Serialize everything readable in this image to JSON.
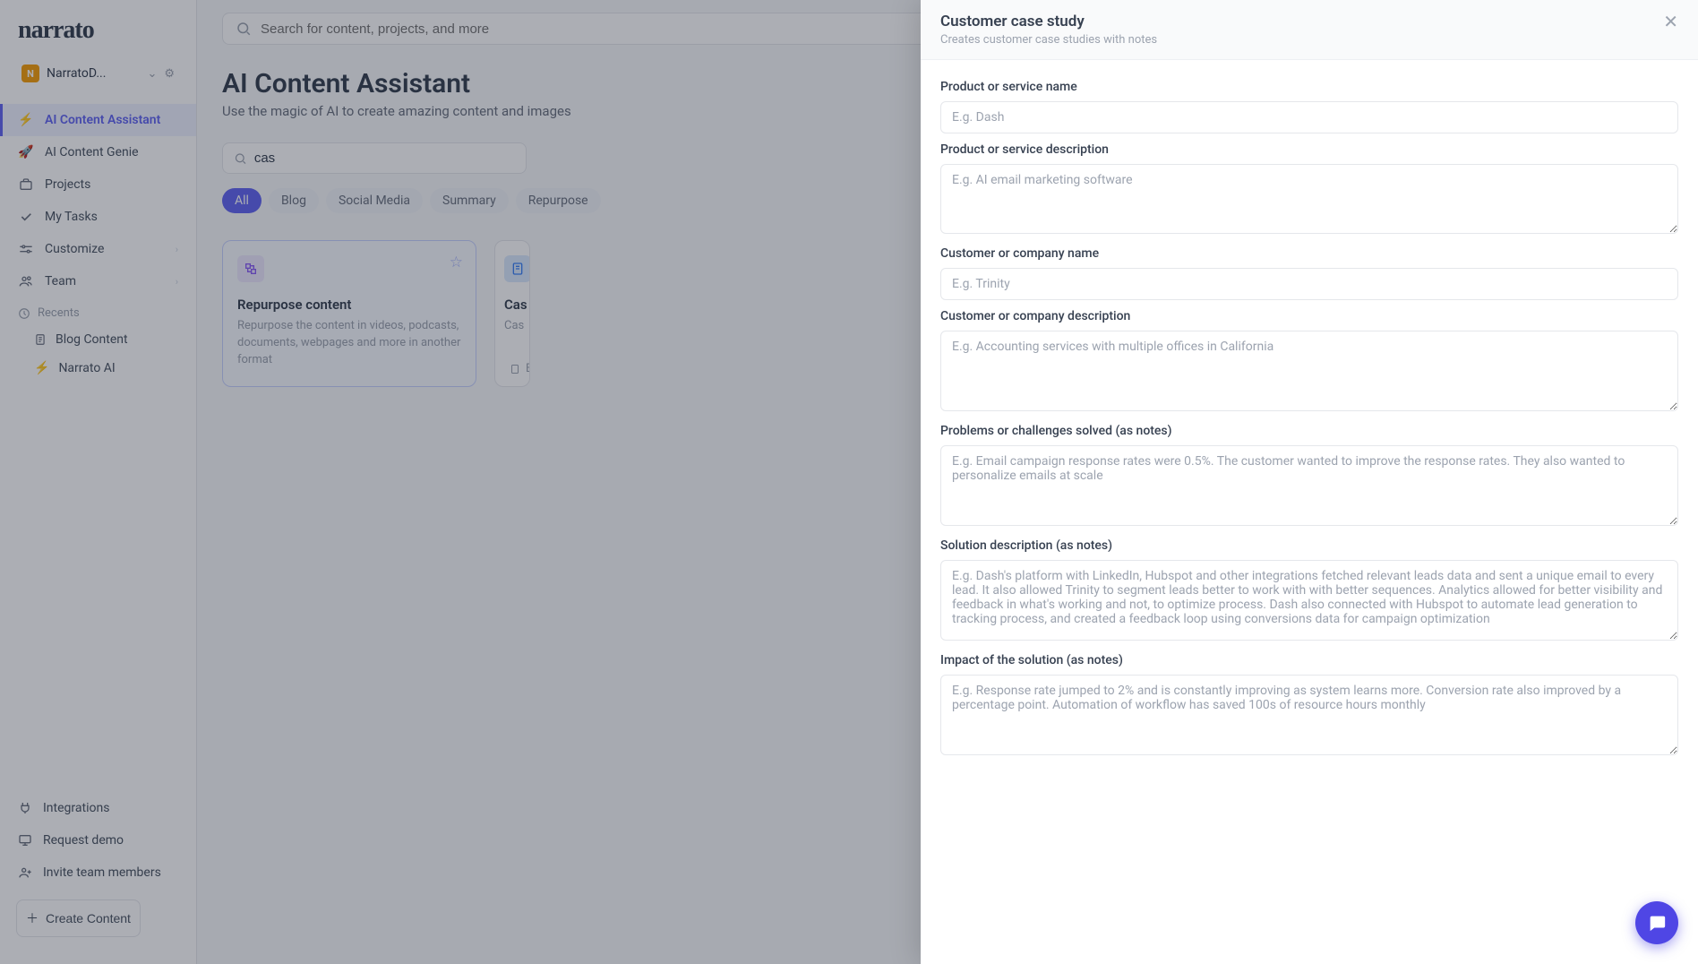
{
  "brand": "narrato",
  "workspace": {
    "badge": "N",
    "name": "NarratoD..."
  },
  "nav": {
    "ai_assistant": "AI Content Assistant",
    "ai_genie": "AI Content Genie",
    "projects": "Projects",
    "my_tasks": "My Tasks",
    "customize": "Customize",
    "team": "Team",
    "recents_label": "Recents",
    "recents": [
      {
        "label": "Blog Content",
        "icon": "doc"
      },
      {
        "label": "Narrato AI",
        "icon": "bolt"
      }
    ]
  },
  "bottom_nav": {
    "integrations": "Integrations",
    "request_demo": "Request demo",
    "invite": "Invite team members",
    "create": "Create Content"
  },
  "search_placeholder": "Search for content, projects, and more",
  "page": {
    "title": "AI Content Assistant",
    "subtitle": "Use the magic of AI to create amazing content and images"
  },
  "filter_search_value": "cas",
  "chips": [
    "All",
    "Blog",
    "Social Media",
    "Summary",
    "Repurpose"
  ],
  "active_chip": "All",
  "cards": [
    {
      "title": "Repurpose content",
      "desc": "Repurpose the content in videos, podcasts, documents, webpages and more in another format",
      "icon_bg": "#ede9fe",
      "icon_color": "#8b5cf6",
      "highlight": true
    },
    {
      "title": "Cas",
      "desc": "Cas",
      "footer": "B",
      "icon_bg": "#dbeafe",
      "icon_color": "#3b82f6",
      "highlight": false
    }
  ],
  "modal": {
    "title": "Customer case study",
    "subtitle": "Creates customer case studies with notes",
    "fields": {
      "product_name": {
        "label": "Product or service name",
        "placeholder": "E.g. Dash"
      },
      "product_desc": {
        "label": "Product or service description",
        "placeholder": "E.g. AI email marketing software"
      },
      "customer_name": {
        "label": "Customer or company name",
        "placeholder": "E.g. Trinity"
      },
      "customer_desc": {
        "label": "Customer or company description",
        "placeholder": "E.g. Accounting services with multiple offices in California"
      },
      "problems": {
        "label": "Problems or challenges solved (as notes)",
        "placeholder": "E.g. Email campaign response rates were 0.5%. The customer wanted to improve the response rates. They also wanted to personalize emails at scale"
      },
      "solution": {
        "label": "Solution description (as notes)",
        "placeholder": "E.g. Dash's platform with LinkedIn, Hubspot and other integrations fetched relevant leads data and sent a unique email to every lead. It also allowed Trinity to segment leads better to work with with better sequences. Analytics allowed for better visibility and feedback in what's working and not, to optimize process. Dash also connected with Hubspot to automate lead generation to tracking process, and created a feedback loop using conversions data for campaign optimization"
      },
      "impact": {
        "label": "Impact of the solution (as notes)",
        "placeholder": "E.g. Response rate jumped to 2% and is constantly improving as system learns more. Conversion rate also improved by a percentage point. Automation of workflow has saved 100s of resource hours monthly"
      }
    }
  }
}
